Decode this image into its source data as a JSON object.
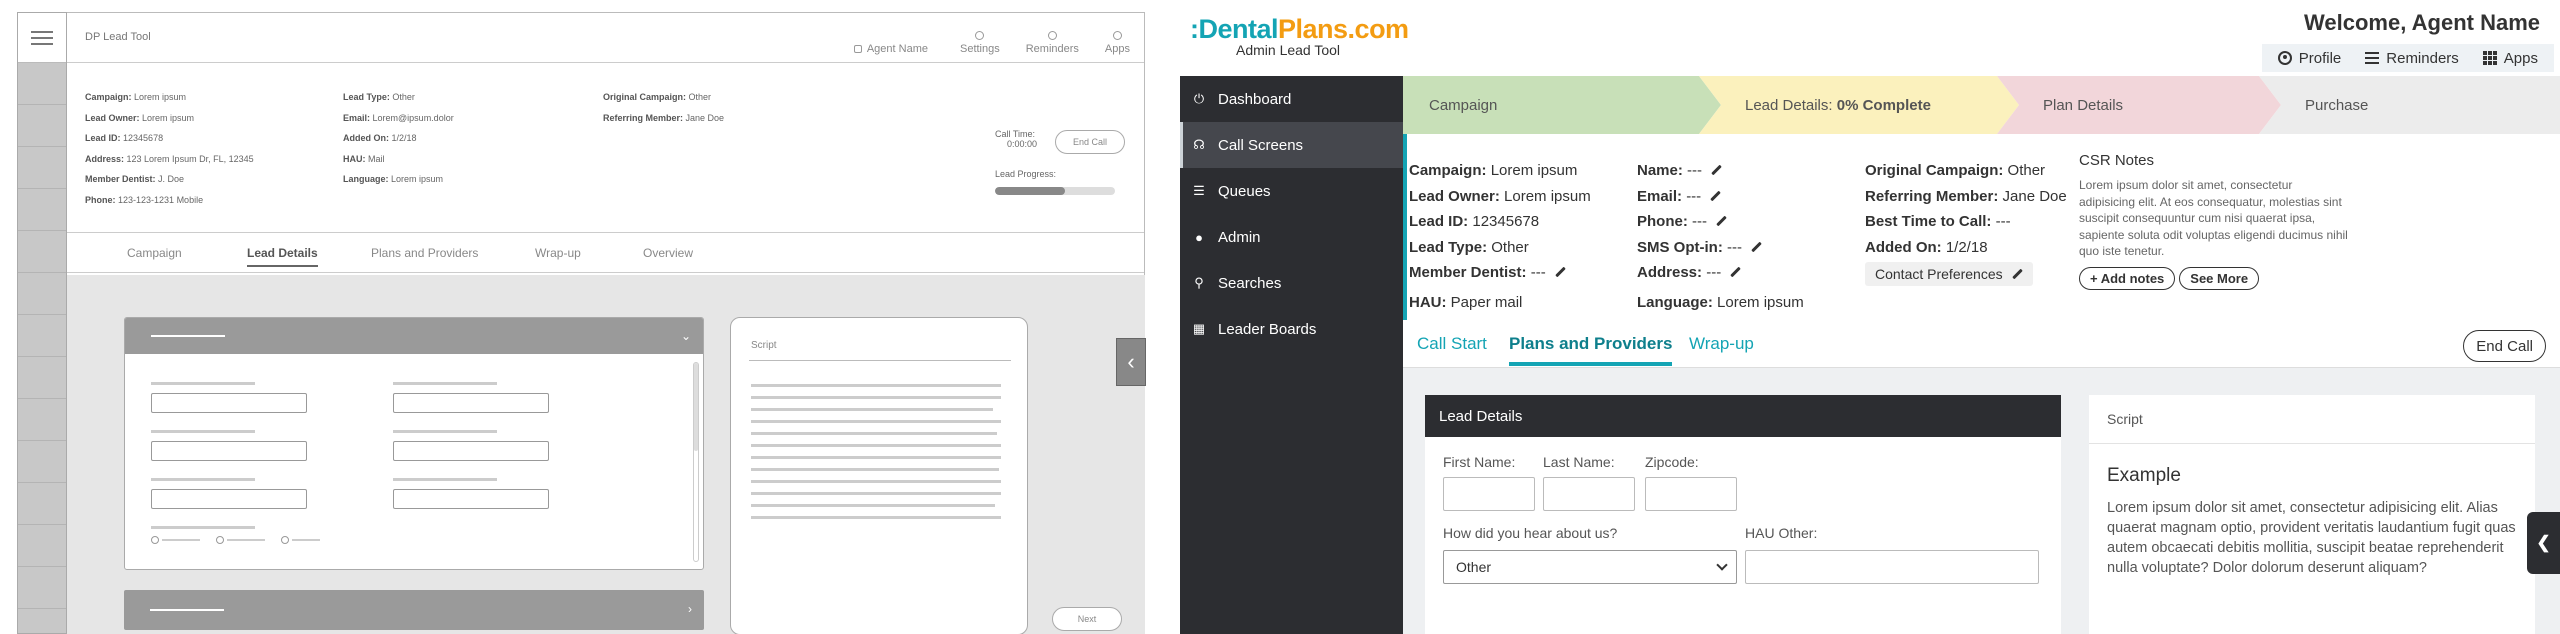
{
  "wireframe": {
    "title": "DP Lead Tool",
    "agent": "Agent Name",
    "top_items": [
      "Settings",
      "Reminders",
      "Apps"
    ],
    "col1": [
      {
        "label": "Campaign:",
        "value": "Lorem ipsum"
      },
      {
        "label": "Lead Owner:",
        "value": "Lorem ipsum"
      },
      {
        "label": "Lead ID:",
        "value": "12345678"
      },
      {
        "label": "Address:",
        "value": "123 Lorem Ipsum Dr, FL, 12345"
      },
      {
        "label": "Member Dentist:",
        "value": "J. Doe"
      },
      {
        "label": "Phone:",
        "value": "123-123-1231 Mobile"
      }
    ],
    "col2": [
      {
        "label": "Lead Type:",
        "value": "Other"
      },
      {
        "label": "Email:",
        "value": "Lorem@ipsum.dolor"
      },
      {
        "label": "Added On:",
        "value": "1/2/18"
      },
      {
        "label": "HAU:",
        "value": "Mail"
      },
      {
        "label": "Language:",
        "value": "Lorem ipsum"
      }
    ],
    "col3": [
      {
        "label": "Original Campaign:",
        "value": "Other"
      },
      {
        "label": "Referring Member:",
        "value": "Jane Doe"
      }
    ],
    "call_time_label": "Call Time:",
    "call_time_value": "0:00:00",
    "end_call": "End Call",
    "lead_progress_label": "Lead Progress:",
    "lead_progress": 0.58,
    "tabs": [
      "Campaign",
      "Lead Details",
      "Plans and Providers",
      "Wrap-up",
      "Overview"
    ],
    "active_tab": "Lead Details",
    "script_title": "Script",
    "next": "Next"
  },
  "app": {
    "logo_part1": ":Dental",
    "logo_part2": "Plans.com",
    "logo_sub": "Admin Lead Tool",
    "welcome": "Welcome, Agent Name",
    "topnav": [
      {
        "label": "Profile",
        "icon": "user-circle-icon"
      },
      {
        "label": "Reminders",
        "icon": "list-icon"
      },
      {
        "label": "Apps",
        "icon": "grid-icon"
      }
    ],
    "sidebar": [
      {
        "label": "Dashboard",
        "icon": "power-icon",
        "glyph": "⏻"
      },
      {
        "label": "Call Screens",
        "icon": "headset-icon",
        "glyph": "☊"
      },
      {
        "label": "Queues",
        "icon": "list-icon",
        "glyph": "☰"
      },
      {
        "label": "Admin",
        "icon": "user-icon",
        "glyph": "●"
      },
      {
        "label": "Searches",
        "icon": "search-icon",
        "glyph": "⚲"
      },
      {
        "label": "Leader Boards",
        "icon": "grid-icon",
        "glyph": "▦"
      }
    ],
    "steps": [
      {
        "label": "Campaign",
        "color": "#c8e0b8"
      },
      {
        "label_prefix": "Lead Details: ",
        "label_bold": "0% Complete",
        "color": "#fbf1bd"
      },
      {
        "label": "Plan Details",
        "color": "#f2d6da"
      },
      {
        "label": "Purchase",
        "color": "#ececec"
      }
    ],
    "summary_col1": [
      {
        "label": "Campaign:",
        "value": "Lorem ipsum"
      },
      {
        "label": "Lead Owner:",
        "value": "Lorem ipsum"
      },
      {
        "label": "Lead ID:",
        "value": "12345678"
      },
      {
        "label": "Lead Type:",
        "value": "Other"
      },
      {
        "label": "Member Dentist:",
        "value": "---"
      },
      {
        "label": "HAU:",
        "value": "Paper mail"
      }
    ],
    "summary_col2": [
      {
        "label": "Name:",
        "value": "---"
      },
      {
        "label": "Email:",
        "value": "---"
      },
      {
        "label": "Phone:",
        "value": "---"
      },
      {
        "label": "SMS Opt-in:",
        "value": "---"
      },
      {
        "label": "Address:",
        "value": "---"
      },
      {
        "label": "Language:",
        "value": "Lorem ipsum"
      }
    ],
    "summary_col3": [
      {
        "label": "Original Campaign:",
        "value": "Other"
      },
      {
        "label": "Referring Member:",
        "value": "Jane Doe"
      },
      {
        "label": "Best Time to Call:",
        "value": "---"
      },
      {
        "label": "Added On:",
        "value": "1/2/18"
      }
    ],
    "contact_preferences": "Contact Preferences",
    "csr_title": "CSR Notes",
    "csr_text": "Lorem ipsum dolor sit amet, consectetur adipisicing elit. At eos consequatur, molestias sint suscipit consequuntur cum nisi quaerat ipsa, sapiente soluta odit voluptas eligendi ducimus nihil quo iste tenetur.",
    "add_notes": "+ Add notes",
    "see_more": "See More",
    "tabs": [
      "Call Start",
      "Plans and Providers",
      "Wrap-up"
    ],
    "active_tab": "Plans and Providers",
    "end_call": "End Call",
    "lead_details_title": "Lead Details",
    "first_name_label": "First Name:",
    "last_name_label": "Last Name:",
    "zipcode_label": "Zipcode:",
    "hear_label": "How did you hear about us?",
    "hear_value": "Other",
    "hau_other_label": "HAU Other:",
    "script_title": "Script",
    "script_heading": "Example",
    "script_text": "Lorem ipsum dolor sit amet, consectetur adipisicing elit. Alias quaerat magnam optio, provident veritatis laudantium fugit quas autem obcaecati debitis mollitia, suscipit beatae reprehenderit nulla voluptate? Dolor dolorum deserunt aliquam?",
    "colors": {
      "brand_teal": "#14a4b4",
      "brand_orange": "#f39c12",
      "sidebar_bg": "#2c2d31"
    }
  }
}
